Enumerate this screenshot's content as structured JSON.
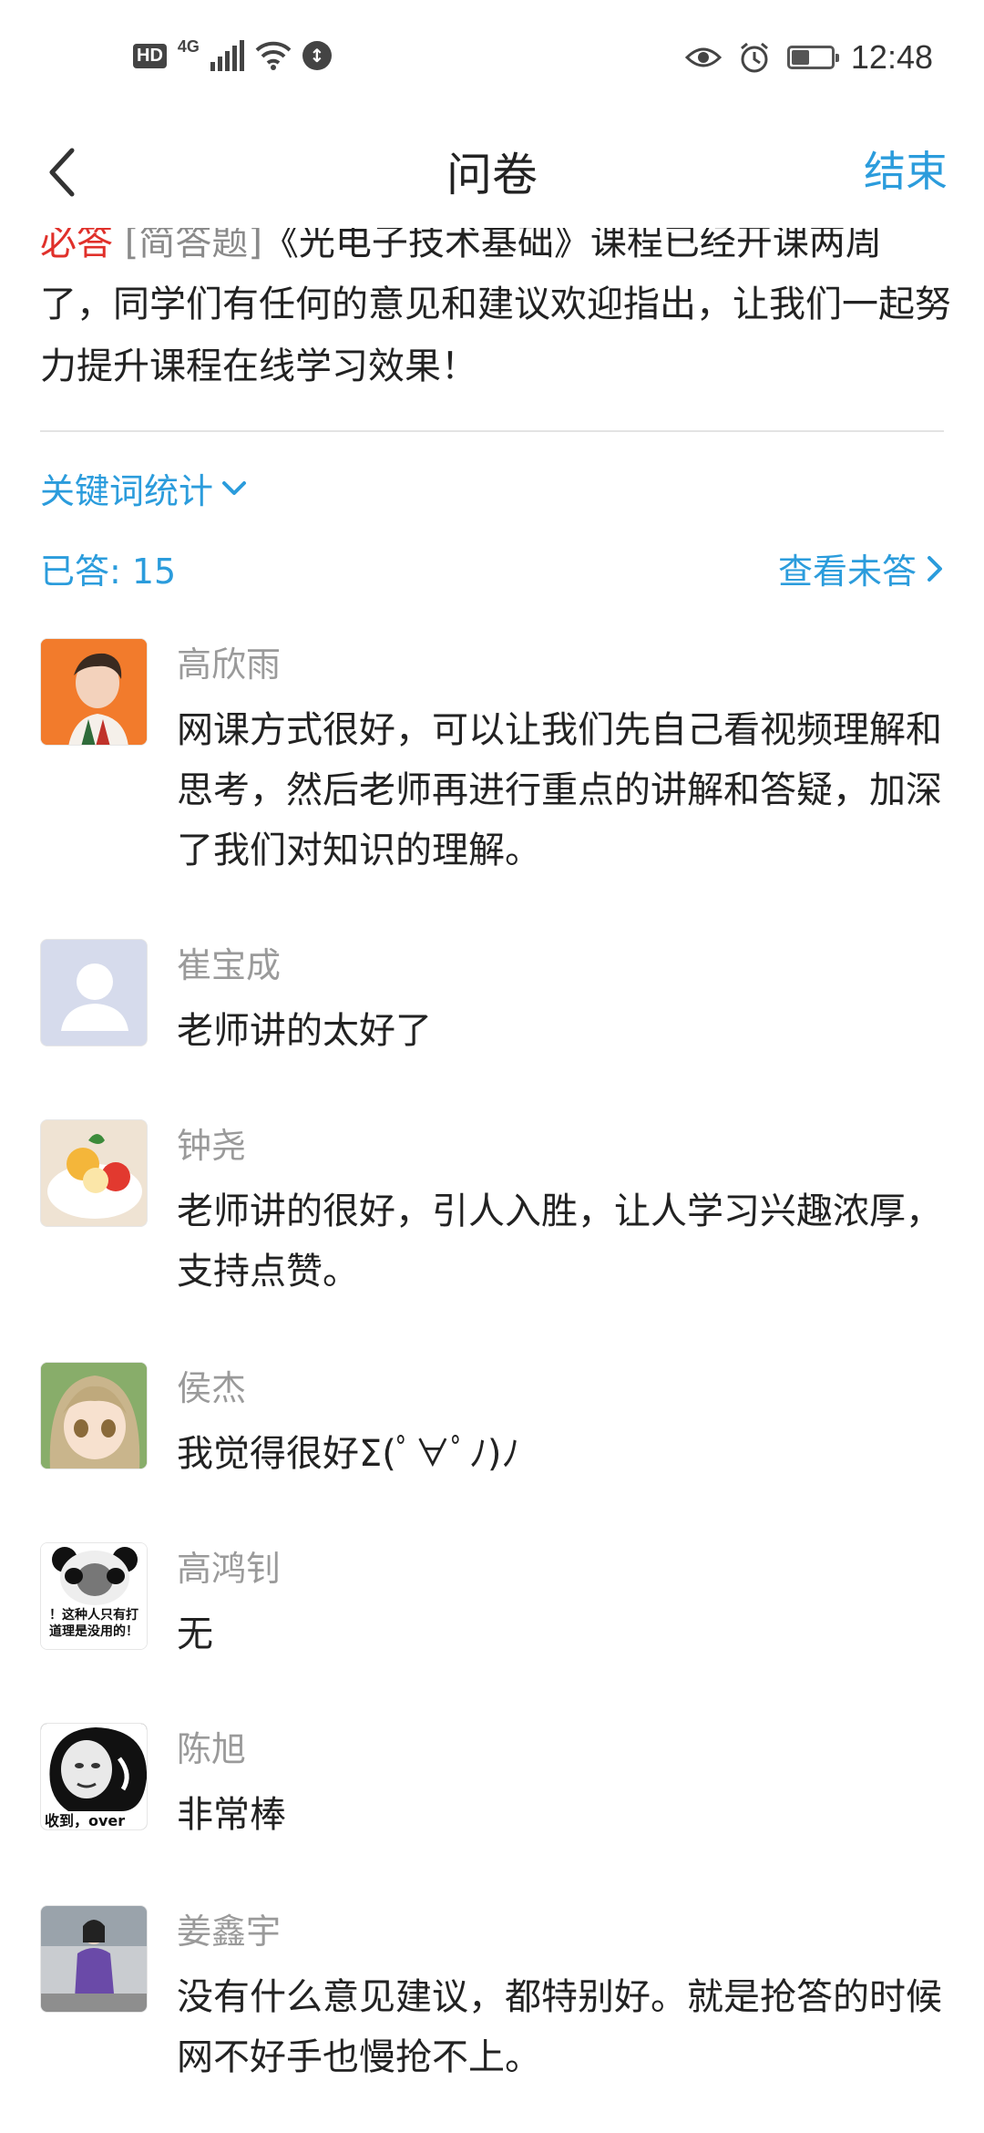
{
  "status_bar": {
    "hd": "HD",
    "network": "4G",
    "data_badge": "↕",
    "time": "12:48",
    "battery_level": 0.45
  },
  "nav": {
    "title": "问卷",
    "end_label": "结束"
  },
  "question": {
    "required_tag": "必答",
    "type_tag": "[简答题]",
    "text": "《光电子技术基础》课程已经开课两周了，同学们有任何的意见和建议欢迎指出，让我们一起努力提升课程在线学习效果！"
  },
  "stats": {
    "keyword_label": "关键词统计",
    "answered_label": "已答: 15",
    "unanswered_label": "查看未答"
  },
  "answers": [
    {
      "name": "高欣雨",
      "text": "网课方式很好，可以让我们先自己看视频理解和思考，然后老师再进行重点的讲解和答疑，加深了我们对知识的理解。",
      "avatar_icon": "portrait-photo-icon"
    },
    {
      "name": "崔宝成",
      "text": "老师讲的太好了",
      "avatar_icon": "default-user-icon"
    },
    {
      "name": "钟尧",
      "text": "老师讲的很好，引人入胜，让人学习兴趣浓厚，支持点赞。",
      "avatar_icon": "dessert-photo-icon"
    },
    {
      "name": "侯杰",
      "text": "我觉得很好Σ(ﾟ∀ﾟﾉ)ﾉ",
      "avatar_icon": "anime-girl-icon"
    },
    {
      "name": "高鸿钊",
      "text": "无",
      "avatar_icon": "panda-meme-icon",
      "avatar_caption": "！这种人只有打\n道理是没用的！"
    },
    {
      "name": "陈旭",
      "text": "非常棒",
      "avatar_icon": "meme-face-icon",
      "avatar_caption": "收到，over"
    },
    {
      "name": "姜鑫宇",
      "text": "没有什么意见建议，都特别好。就是抢答的时候网不好手也慢抢不上。",
      "avatar_icon": "purple-coat-photo-icon"
    }
  ]
}
